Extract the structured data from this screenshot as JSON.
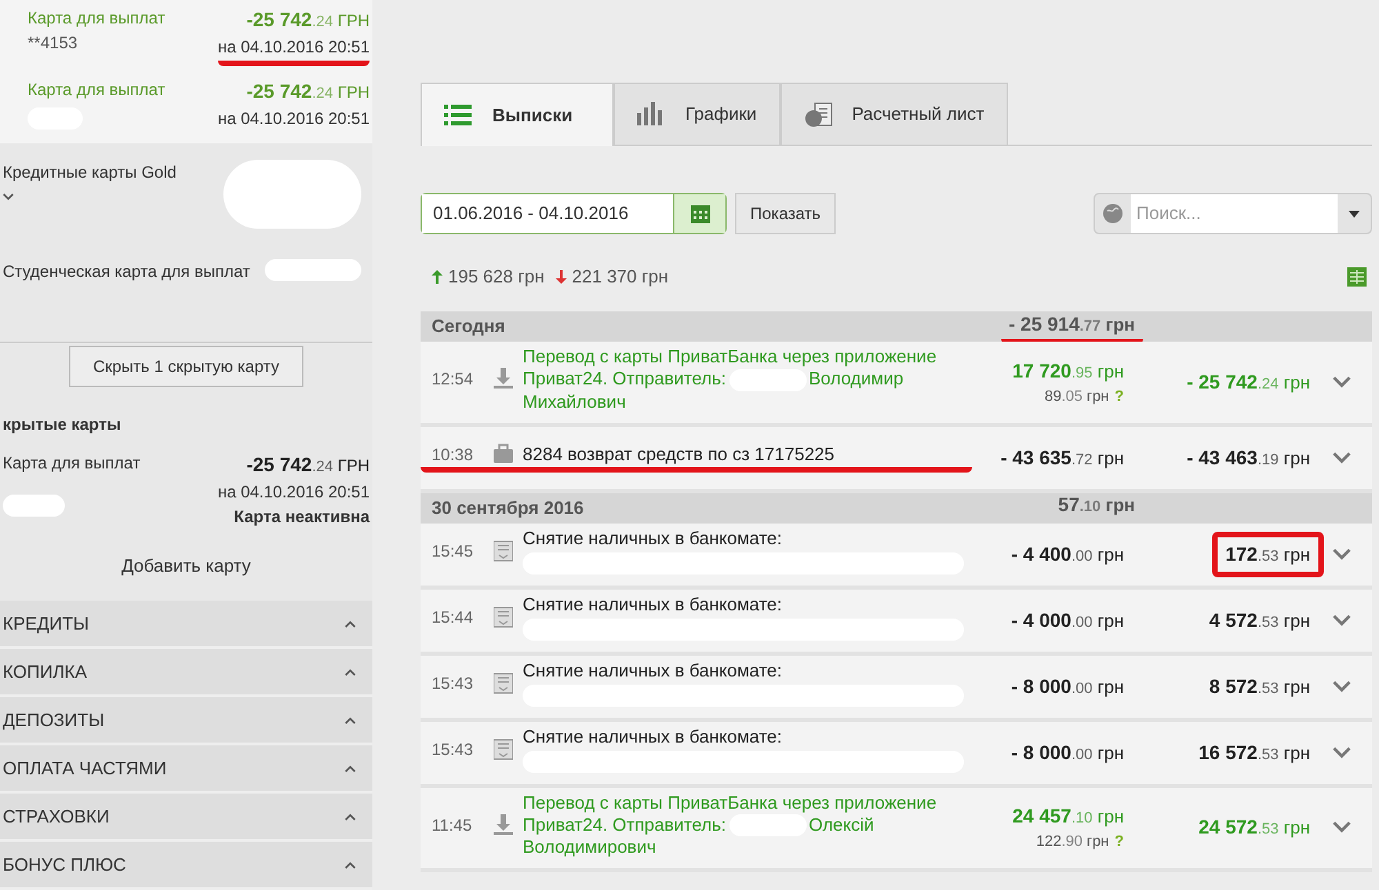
{
  "cards": [
    {
      "name": "Карта для выплат",
      "number": "**4153",
      "redacted_number": false,
      "amount": {
        "int": "-25 742",
        "dec": ".24",
        "cur": "ГРН"
      },
      "date": "на 04.10.2016 20:51",
      "marked": true
    },
    {
      "name": "Карта для выплат",
      "redacted_number": true,
      "amount": {
        "int": "-25 742",
        "dec": ".24",
        "cur": "ГРН"
      },
      "date": "на 04.10.2016 20:51",
      "marked": false
    }
  ],
  "card_groups": [
    {
      "name": "Кредитные карты Gold",
      "kind": "expandable"
    },
    {
      "name": "Студенческая карта для выплат",
      "kind": "plain"
    }
  ],
  "hide_button": "Скрыть 1 скрытую карту",
  "hidden_section": {
    "title": "крытые карты",
    "cards": [
      {
        "name": "Карта для выплат",
        "amount": {
          "int": "-25 742",
          "dec": ".24",
          "cur": "ГРН"
        },
        "date": "на 04.10.2016 20:51",
        "status": "Карта неактивна"
      }
    ]
  },
  "add_card": "Добавить карту",
  "sections": [
    {
      "label": "КРЕДИТЫ"
    },
    {
      "label": "КОПИЛКА"
    },
    {
      "label": "ДЕПОЗИТЫ"
    },
    {
      "label": "ОПЛАТА ЧАСТЯМИ"
    },
    {
      "label": "СТРАХОВКИ"
    },
    {
      "label": "БОНУС ПЛЮС"
    }
  ],
  "tabs": [
    {
      "label": "Выписки",
      "kind": "list",
      "selected": true
    },
    {
      "label": "Графики",
      "kind": "bars",
      "selected": false
    },
    {
      "label": "Расчетный лист",
      "kind": "document",
      "selected": false
    }
  ],
  "date_range": "01.06.2016 - 04.10.2016",
  "show_button": "Показать",
  "search": {
    "placeholder": "Поиск..."
  },
  "totals": {
    "income": "195 628 грн",
    "expense": "221 370 грн"
  },
  "days": [
    {
      "title": "Сегодня",
      "total": {
        "int": "- 25 914",
        "dec": ".77",
        "cur": "грн"
      },
      "marked": true,
      "transactions": [
        {
          "time": "12:54",
          "kind": "transfer_in",
          "text": "Перевод с карты ПриватБанка через приложение Приват24. Отправитель:",
          "redacted": true,
          "name": "Володимир Михайлович",
          "amount": {
            "int": "17 720",
            "dec": ".95",
            "cur": "грн"
          },
          "fee": {
            "int": "89",
            "dec": ".05",
            "cur": "грн"
          },
          "fee_hint": "?",
          "balance": {
            "int": "- 25 742",
            "dec": ".24",
            "cur": "грн"
          },
          "marked": false,
          "balance_marked": false
        },
        {
          "time": "10:38",
          "kind": "refund",
          "text": "8284 возврат средств по сз 17175225",
          "redacted": false,
          "marked": true,
          "amount": {
            "int": "- 43 635",
            "dec": ".72",
            "cur": "грн"
          },
          "balance": {
            "int": "- 43 463",
            "dec": ".19",
            "cur": "грн"
          },
          "balance_marked": false
        }
      ]
    },
    {
      "title": "30 сентября 2016",
      "total": {
        "int": "57",
        "dec": ".10",
        "cur": "грн"
      },
      "marked": false,
      "transactions": [
        {
          "time": "15:45",
          "kind": "atm_withdrawal",
          "text": "Снятие наличных в банкомате:",
          "redacted": true,
          "amount": {
            "int": "- 4 400",
            "dec": ".00",
            "cur": "грн"
          },
          "balance": {
            "int": "172",
            "dec": ".53",
            "cur": "грн"
          },
          "marked": false,
          "balance_marked": true
        },
        {
          "time": "15:44",
          "kind": "atm_withdrawal",
          "text": "Снятие наличных в банкомате:",
          "redacted": true,
          "amount": {
            "int": "- 4 000",
            "dec": ".00",
            "cur": "грн"
          },
          "balance": {
            "int": "4 572",
            "dec": ".53",
            "cur": "грн"
          },
          "marked": false,
          "balance_marked": false
        },
        {
          "time": "15:43",
          "kind": "atm_withdrawal",
          "text": "Снятие наличных в банкомате:",
          "redacted": true,
          "amount": {
            "int": "- 8 000",
            "dec": ".00",
            "cur": "грн"
          },
          "balance": {
            "int": "8 572",
            "dec": ".53",
            "cur": "грн"
          },
          "marked": false,
          "balance_marked": false
        },
        {
          "time": "15:43",
          "kind": "atm_withdrawal",
          "text": "Снятие наличных в банкомате:",
          "redacted": true,
          "amount": {
            "int": "- 8 000",
            "dec": ".00",
            "cur": "грн"
          },
          "balance": {
            "int": "16 572",
            "dec": ".53",
            "cur": "грн"
          },
          "marked": false,
          "balance_marked": false
        },
        {
          "time": "11:45",
          "kind": "transfer_in",
          "text": "Перевод с карты ПриватБанка через приложение Приват24. Отправитель:",
          "redacted": true,
          "name": "Олексій Володимирович",
          "amount": {
            "int": "24 457",
            "dec": ".10",
            "cur": "грн"
          },
          "fee": {
            "int": "122",
            "dec": ".90",
            "cur": "грн"
          },
          "fee_hint": "?",
          "balance": {
            "int": "24 572",
            "dec": ".53",
            "cur": "грн"
          },
          "marked": false,
          "balance_marked": false
        }
      ]
    }
  ]
}
